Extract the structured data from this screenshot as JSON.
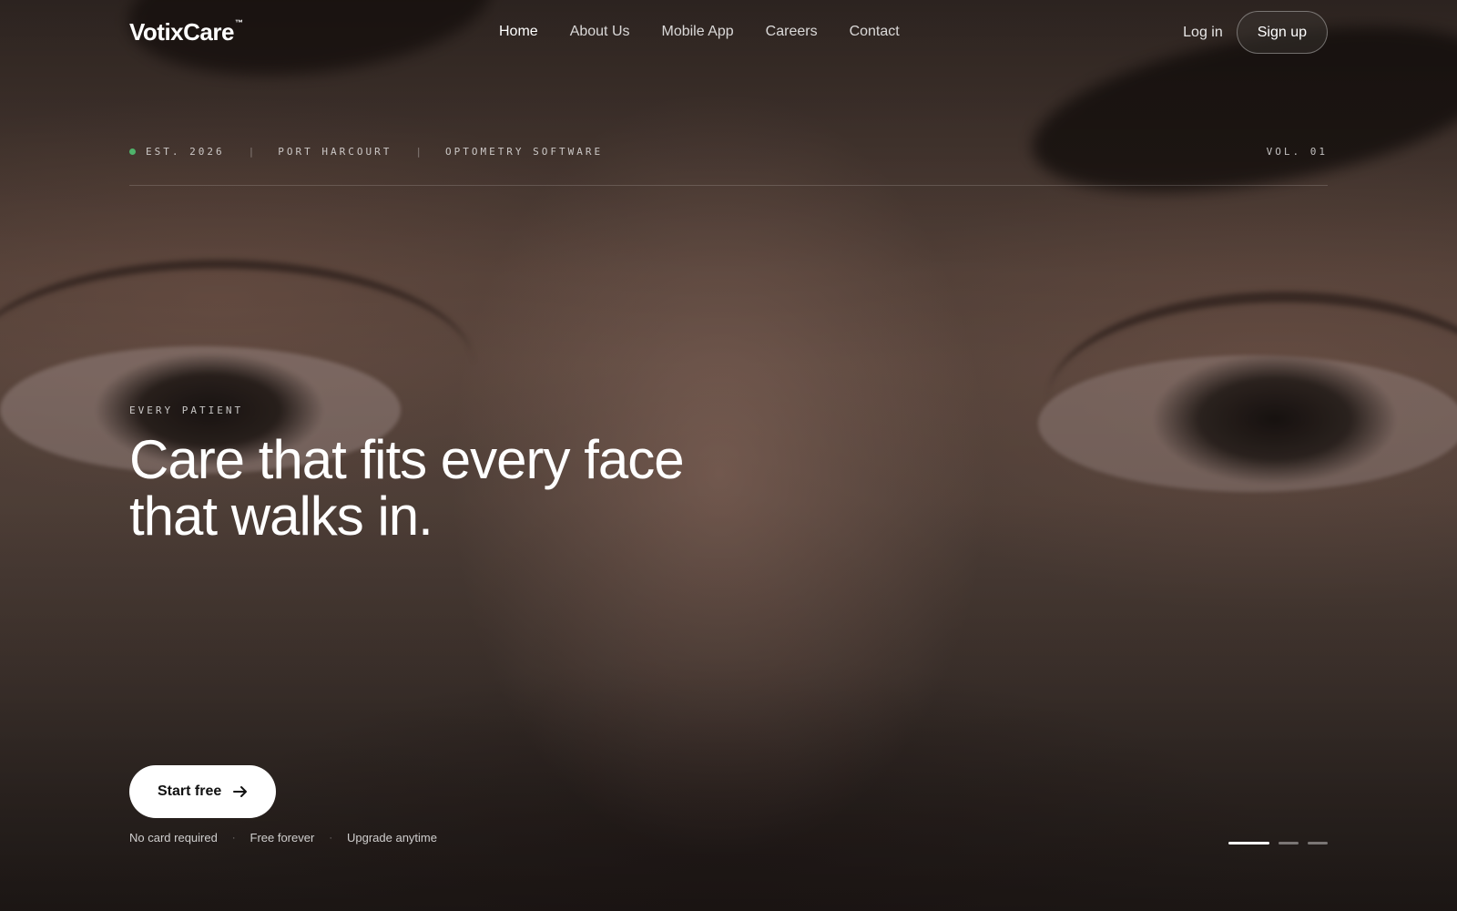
{
  "brand": {
    "name": "VotixCare",
    "trademark": "™"
  },
  "nav": {
    "links": [
      "Home",
      "About Us",
      "Mobile App",
      "Careers",
      "Contact"
    ],
    "active": "Home",
    "login_label": "Log in",
    "signup_label": "Sign up"
  },
  "meta": {
    "established": "EST. 2026",
    "location": "PORT HARCOURT",
    "category": "OPTOMETRY SOFTWARE",
    "volume": "VOL. 01",
    "separator": "|",
    "status_color": "#4fb36b"
  },
  "hero": {
    "eyebrow": "EVERY PATIENT",
    "headline_line1": "Care that fits every face",
    "headline_line2": "that walks in.",
    "background": "close-up photo of a person's eyes"
  },
  "cta": {
    "label": "Start free",
    "icon": "arrow-right-icon"
  },
  "notes": [
    "No card required",
    "Free forever",
    "Upgrade anytime"
  ],
  "note_separator": "·",
  "pager": {
    "slides": 3,
    "active_index": 0
  }
}
